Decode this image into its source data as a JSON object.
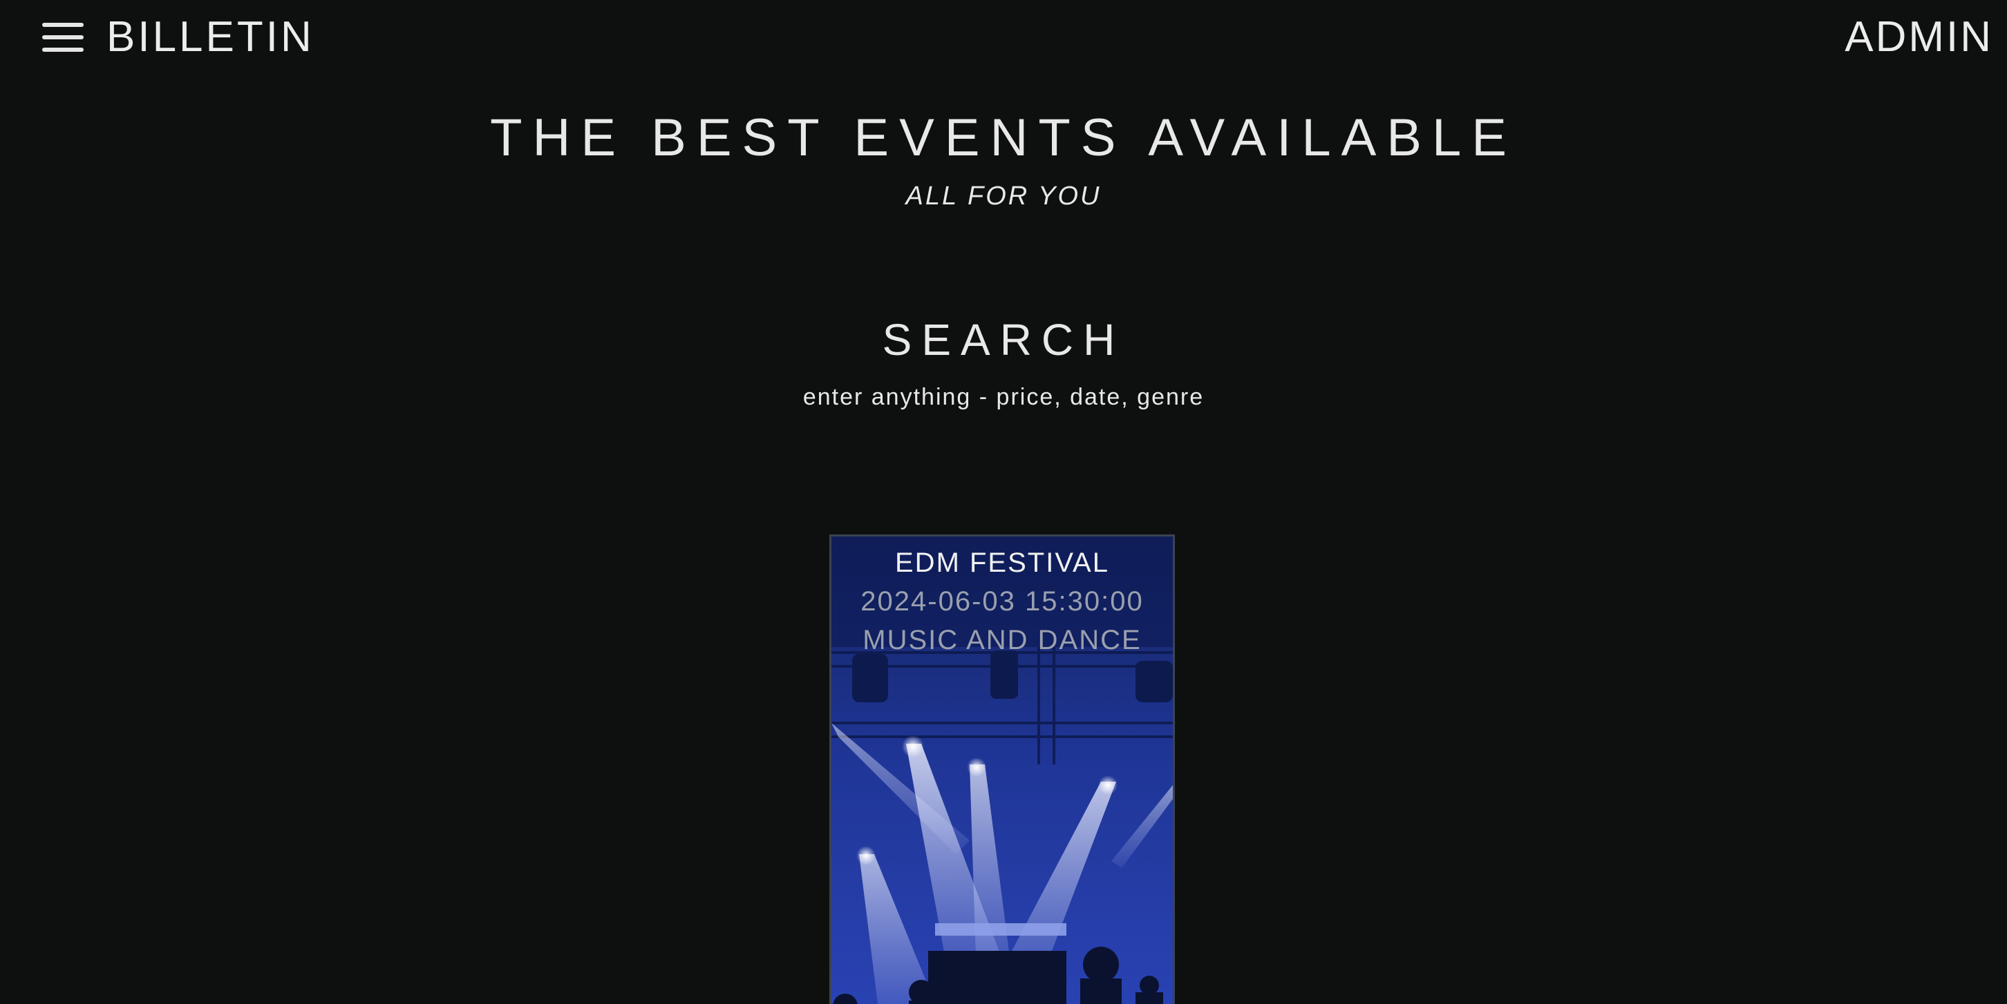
{
  "header": {
    "brand": "BILLETIN",
    "admin_label": "ADMIN",
    "menu_icon": "hamburger-menu-icon"
  },
  "hero": {
    "title": "THE BEST EVENTS AVAILABLE",
    "subtitle": "ALL FOR YOU"
  },
  "search": {
    "title": "SEARCH",
    "hint": "enter anything - price, date, genre"
  },
  "events": [
    {
      "name": "EDM FESTIVAL",
      "datetime": "2024-06-03 15:30:00",
      "genre": "MUSIC AND DANCE"
    }
  ],
  "colors": {
    "background": "#0e100f",
    "text": "#e8e8e8",
    "card_tint": "#1b2f86",
    "card_border": "#3b4450"
  }
}
